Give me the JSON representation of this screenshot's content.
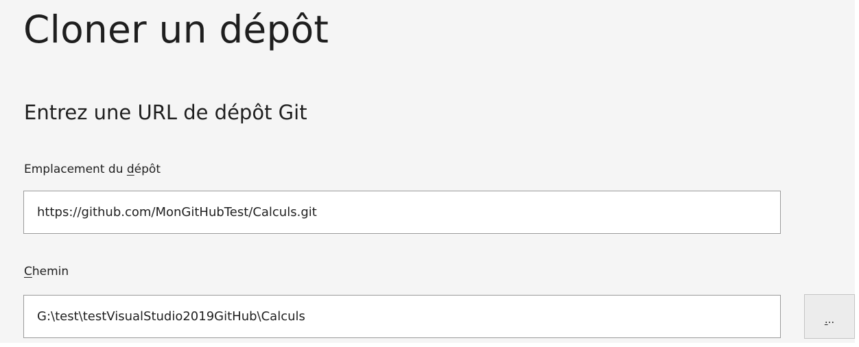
{
  "dialog": {
    "title": "Cloner un dépôt",
    "subtitle": "Entrez une URL de dépôt Git"
  },
  "repository_location": {
    "label_prefix": "Emplacement du ",
    "label_accesskey": "d",
    "label_suffix": "épôt",
    "value": "https://github.com/MonGitHubTest/Calculs.git"
  },
  "path": {
    "label_accesskey": "C",
    "label_suffix": "hemin",
    "value": "G:\\test\\testVisualStudio2019GitHub\\Calculs"
  },
  "browse_button": {
    "accesskey": ".",
    "rest": ".."
  }
}
